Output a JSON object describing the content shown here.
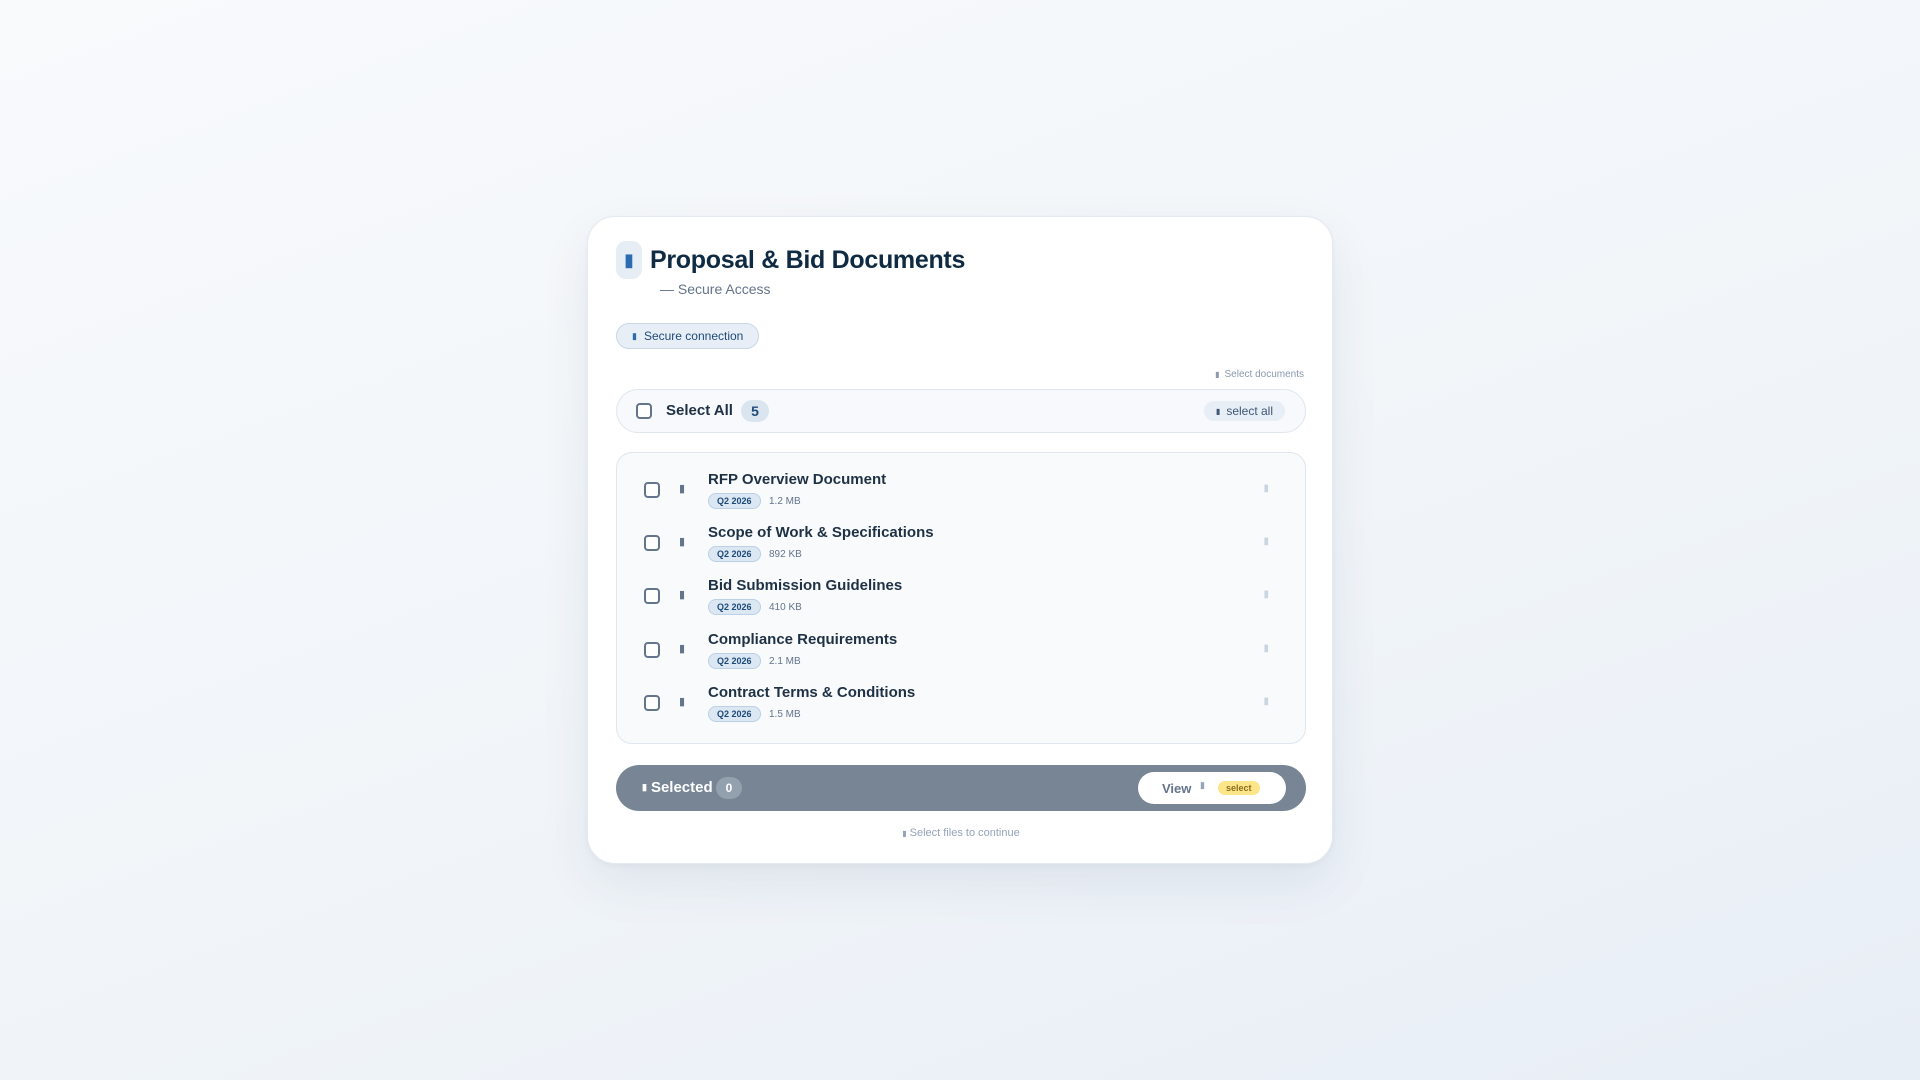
{
  "header": {
    "icon": "folder-icon",
    "title": "Proposal & Bid Documents",
    "subtitle": "— Secure Access"
  },
  "security": {
    "icon": "lock-icon",
    "label": "Secure connection"
  },
  "hint_top": {
    "icon": "info-icon",
    "label": "Select documents"
  },
  "select_all": {
    "label": "Select All",
    "count": "5",
    "chip_icon": "pointer-icon",
    "chip_label": "select all"
  },
  "documents": [
    {
      "name": "RFP Overview Document",
      "quarter": "Q2 2026",
      "size": "1.2 MB",
      "icon": "file-icon"
    },
    {
      "name": "Scope of Work & Specifications",
      "quarter": "Q2 2026",
      "size": "892 KB",
      "icon": "file-icon"
    },
    {
      "name": "Bid Submission Guidelines",
      "quarter": "Q2 2026",
      "size": "410 KB",
      "icon": "file-icon"
    },
    {
      "name": "Compliance Requirements",
      "quarter": "Q2 2026",
      "size": "2.1 MB",
      "icon": "file-icon"
    },
    {
      "name": "Contract Terms & Conditions",
      "quarter": "Q2 2026",
      "size": "1.5 MB",
      "icon": "file-icon"
    }
  ],
  "action_bar": {
    "selected_icon": "check-icon",
    "selected_label": "Selected",
    "selected_count": "0",
    "view_label": "View",
    "view_icon": "eye-icon",
    "view_tag": "select"
  },
  "footer": {
    "icon": "info-icon",
    "hint": "Select files to continue"
  },
  "colors": {
    "primary": "#0f2a43",
    "accent": "#2b6cb0",
    "action_bar": "#778594",
    "tag_yellow": "#fde68a"
  }
}
